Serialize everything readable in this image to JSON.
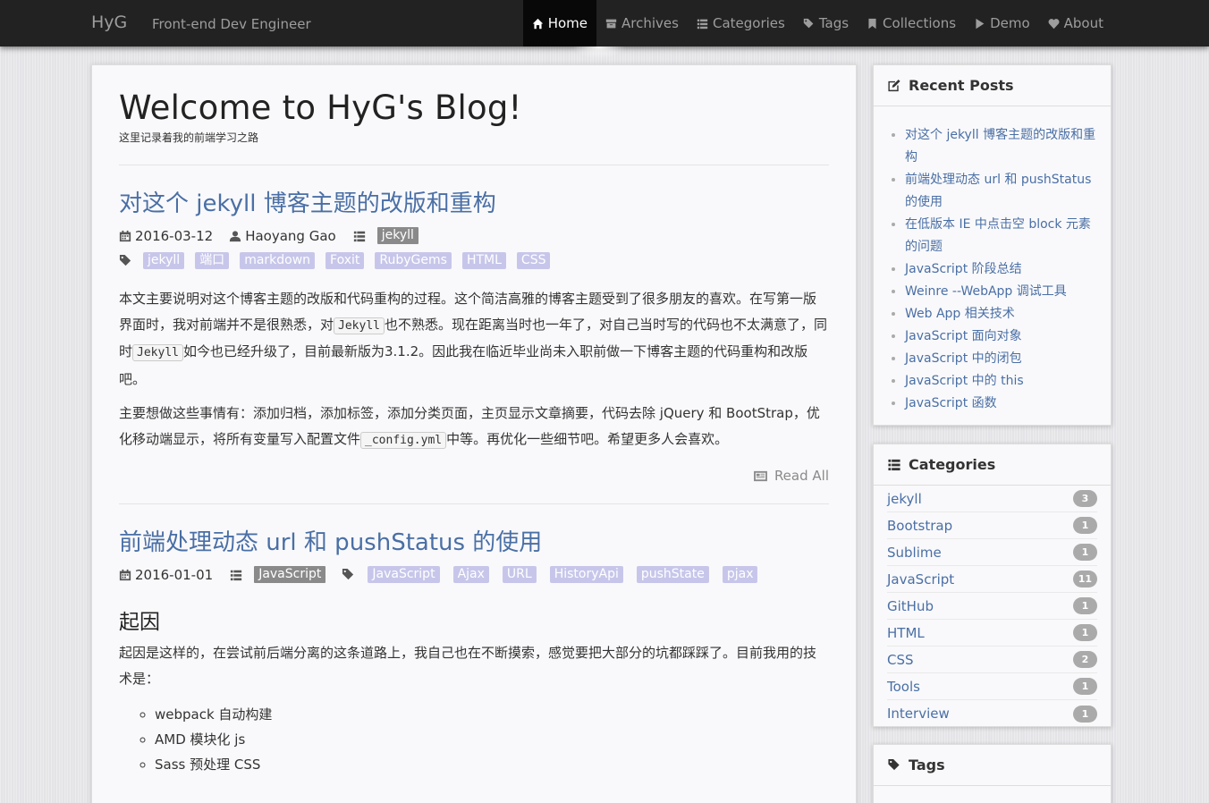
{
  "nav": {
    "brand": "HyG",
    "tagline": "Front-end Dev Engineer",
    "items": [
      {
        "label": "Home",
        "icon": "home-icon",
        "active": true
      },
      {
        "label": "Archives",
        "icon": "archive-icon",
        "active": false
      },
      {
        "label": "Categories",
        "icon": "list-icon",
        "active": false
      },
      {
        "label": "Tags",
        "icon": "tags-icon",
        "active": false
      },
      {
        "label": "Collections",
        "icon": "bookmark-icon",
        "active": false
      },
      {
        "label": "Demo",
        "icon": "play-icon",
        "active": false
      },
      {
        "label": "About",
        "icon": "heart-icon",
        "active": false
      }
    ]
  },
  "page": {
    "title": "Welcome to HyG's Blog!",
    "subtitle": "这里记录着我的前端学习之路"
  },
  "posts": [
    {
      "title": "对这个 jekyll 博客主题的改版和重构",
      "date": "2016-03-12",
      "author": "Haoyang Gao",
      "category": "jekyll",
      "tags": [
        "jekyll",
        "端口",
        "markdown",
        "Foxit",
        "RubyGems",
        "HTML",
        "CSS"
      ],
      "p1": {
        "a": "本文主要说明对这个博客主题的改版和代码重构的过程。这个简洁高雅的博客主题受到了很多朋友的喜欢。在写第一版界面时，我对前端并不是很熟悉，对",
        "code1": "Jekyll",
        "b": "也不熟悉。现在距离当时也一年了，对自己当时写的代码也不太满意了，同时",
        "code2": "Jekyll",
        "c": "如今也已经升级了，目前最新版为3.1.2。因此我在临近毕业尚未入职前做一下博客主题的代码重构和改版吧。"
      },
      "p2": {
        "a": "主要想做这些事情有：添加归档，添加标签，添加分类页面，主页显示文章摘要，代码去除 jQuery 和 BootStrap，优化移动端显示，将所有变量写入配置文件",
        "code1": "_config.yml",
        "b": "中等。再优化一些细节吧。希望更多人会喜欢。"
      },
      "read_all": "Read All"
    },
    {
      "title": "前端处理动态 url 和 pushStatus 的使用",
      "date": "2016-01-01",
      "category": "JavaScript",
      "tags": [
        "JavaScript",
        "Ajax",
        "URL",
        "HistoryApi",
        "pushState",
        "pjax"
      ],
      "heading": "起因",
      "para": "起因是这样的，在尝试前后端分离的这条道路上，我自己也在不断摸索，感觉要把大部分的坑都踩踩了。目前我用的技术是：",
      "list": [
        "webpack 自动构建",
        "AMD 模块化 js",
        "Sass 预处理 CSS"
      ]
    }
  ],
  "sidebar": {
    "recent_title": "Recent Posts",
    "recent": [
      "对这个 jekyll 博客主题的改版和重构",
      "前端处理动态 url 和 pushStatus 的使用",
      "在低版本 IE 中点击空 block 元素的问题",
      "JavaScript 阶段总结",
      "Weinre --WebApp 调试工具",
      "Web App 相关技术",
      "JavaScript 面向对象",
      "JavaScript 中的闭包",
      "JavaScript 中的 this",
      "JavaScript 函数"
    ],
    "categories_title": "Categories",
    "categories": [
      {
        "name": "jekyll",
        "count": "3"
      },
      {
        "name": "Bootstrap",
        "count": "1"
      },
      {
        "name": "Sublime",
        "count": "1"
      },
      {
        "name": "JavaScript",
        "count": "11"
      },
      {
        "name": "GitHub",
        "count": "1"
      },
      {
        "name": "HTML",
        "count": "1"
      },
      {
        "name": "CSS",
        "count": "2"
      },
      {
        "name": "Tools",
        "count": "1"
      },
      {
        "name": "Interview",
        "count": "1"
      }
    ],
    "tags_title": "Tags"
  },
  "colors": {
    "navbar": "#222222",
    "link": "#4a6fa5",
    "tag_bg": "#c7c6ea",
    "category_bg": "#8a8a8a",
    "badge_bg": "#aaaaaa"
  }
}
